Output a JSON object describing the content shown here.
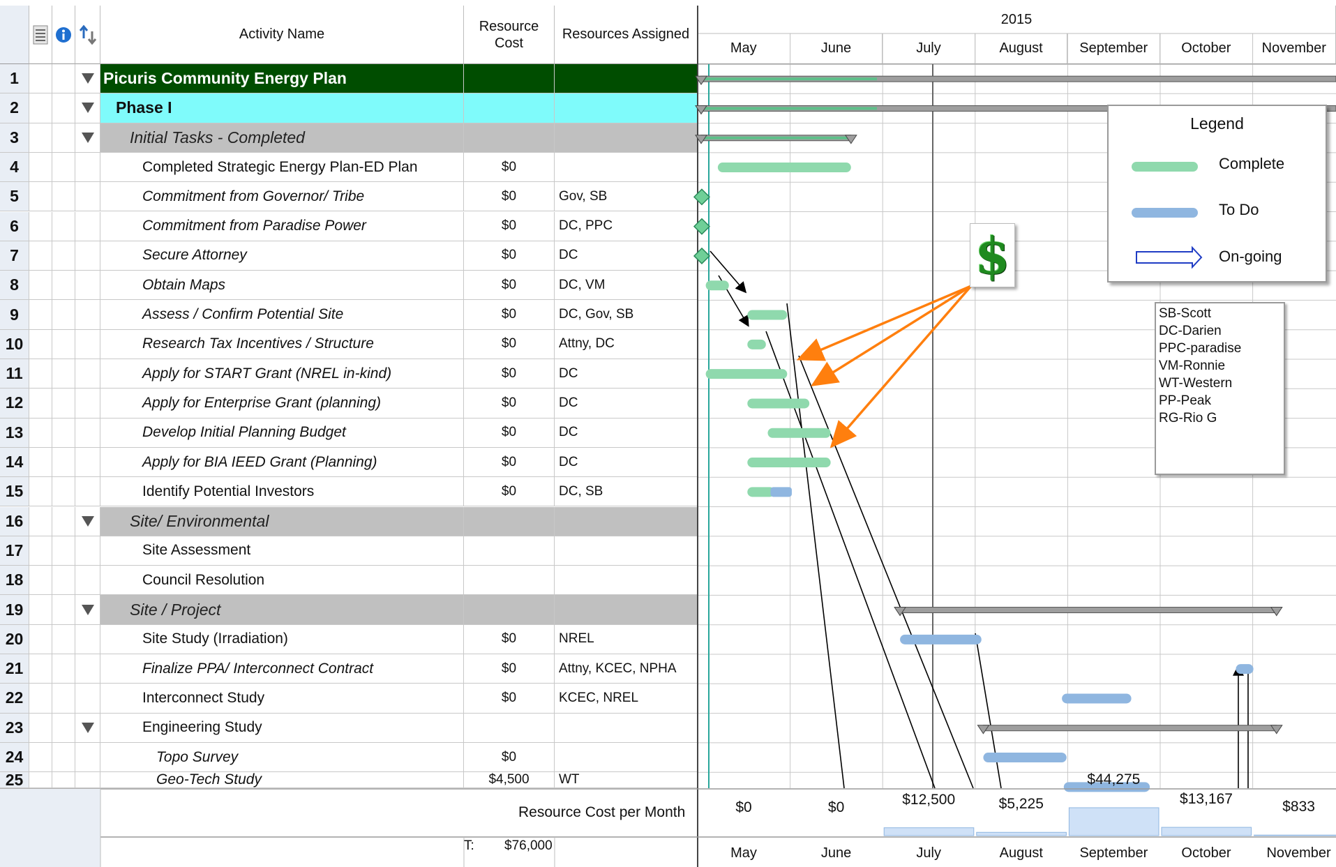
{
  "header": {
    "activity_name": "Activity Name",
    "resource_cost": "Resource Cost",
    "resources_assigned": "Resources Assigned",
    "year": "2015",
    "months": [
      "May",
      "June",
      "July",
      "August",
      "September",
      "October",
      "November"
    ]
  },
  "icons": [
    "notes-icon",
    "info-icon",
    "link-icon"
  ],
  "rows": [
    {
      "num": "1",
      "name": "Picuris Community Energy Plan",
      "cost": "",
      "res": "",
      "level": "root",
      "toggle": true,
      "italic": false,
      "indent": 0
    },
    {
      "num": "2",
      "name": "Phase I",
      "cost": "",
      "res": "",
      "level": "phase",
      "toggle": true,
      "italic": false,
      "indent": 1
    },
    {
      "num": "3",
      "name": "Initial Tasks - Completed",
      "cost": "",
      "res": "",
      "level": "sum",
      "toggle": true,
      "italic": true,
      "indent": 2
    },
    {
      "num": "4",
      "name": "Completed Strategic Energy Plan-ED Plan",
      "cost": "$0",
      "res": "",
      "level": "task",
      "toggle": false,
      "italic": false,
      "indent": 3
    },
    {
      "num": "5",
      "name": "Commitment from Governor/ Tribe",
      "cost": "$0",
      "res": "Gov, SB",
      "level": "task",
      "toggle": false,
      "italic": true,
      "indent": 3
    },
    {
      "num": "6",
      "name": "Commitment from Paradise Power",
      "cost": "$0",
      "res": "DC, PPC",
      "level": "task",
      "toggle": false,
      "italic": true,
      "indent": 3
    },
    {
      "num": "7",
      "name": "Secure Attorney",
      "cost": "$0",
      "res": "DC",
      "level": "task",
      "toggle": false,
      "italic": true,
      "indent": 3
    },
    {
      "num": "8",
      "name": "Obtain Maps",
      "cost": "$0",
      "res": "DC, VM",
      "level": "task",
      "toggle": false,
      "italic": true,
      "indent": 3
    },
    {
      "num": "9",
      "name": "Assess / Confirm Potential Site",
      "cost": "$0",
      "res": "DC, Gov, SB",
      "level": "task",
      "toggle": false,
      "italic": true,
      "indent": 3
    },
    {
      "num": "10",
      "name": "Research Tax Incentives / Structure",
      "cost": "$0",
      "res": "Attny, DC",
      "level": "task",
      "toggle": false,
      "italic": true,
      "indent": 3
    },
    {
      "num": "11",
      "name": "Apply for START Grant (NREL in-kind)",
      "cost": "$0",
      "res": "DC",
      "level": "task",
      "toggle": false,
      "italic": true,
      "indent": 3
    },
    {
      "num": "12",
      "name": "Apply for Enterprise Grant (planning)",
      "cost": "$0",
      "res": "DC",
      "level": "task",
      "toggle": false,
      "italic": true,
      "indent": 3
    },
    {
      "num": "13",
      "name": "Develop Initial Planning Budget",
      "cost": "$0",
      "res": "DC",
      "level": "task",
      "toggle": false,
      "italic": true,
      "indent": 3
    },
    {
      "num": "14",
      "name": "Apply for BIA IEED Grant (Planning)",
      "cost": "$0",
      "res": "DC",
      "level": "task",
      "toggle": false,
      "italic": true,
      "indent": 3
    },
    {
      "num": "15",
      "name": "Identify Potential Investors",
      "cost": "$0",
      "res": "DC, SB",
      "level": "task",
      "toggle": false,
      "italic": false,
      "indent": 3
    },
    {
      "num": "16",
      "name": "Site/ Environmental",
      "cost": "",
      "res": "",
      "level": "sum",
      "toggle": true,
      "italic": true,
      "indent": 2
    },
    {
      "num": "17",
      "name": "Site Assessment",
      "cost": "",
      "res": "",
      "level": "task",
      "toggle": false,
      "italic": false,
      "indent": 3
    },
    {
      "num": "18",
      "name": "Council Resolution",
      "cost": "",
      "res": "",
      "level": "task",
      "toggle": false,
      "italic": false,
      "indent": 3
    },
    {
      "num": "19",
      "name": "Site / Project",
      "cost": "",
      "res": "",
      "level": "sum",
      "toggle": true,
      "italic": true,
      "indent": 2
    },
    {
      "num": "20",
      "name": "Site Study (Irradiation)",
      "cost": "$0",
      "res": "NREL",
      "level": "task",
      "toggle": false,
      "italic": false,
      "indent": 3
    },
    {
      "num": "21",
      "name": "Finalize PPA/ Interconnect Contract",
      "cost": "$0",
      "res": "Attny, KCEC, NPHA",
      "level": "task",
      "toggle": false,
      "italic": true,
      "indent": 3
    },
    {
      "num": "22",
      "name": "Interconnect Study",
      "cost": "$0",
      "res": "KCEC, NREL",
      "level": "task",
      "toggle": false,
      "italic": false,
      "indent": 3
    },
    {
      "num": "23",
      "name": "Engineering Study",
      "cost": "",
      "res": "",
      "level": "task",
      "toggle": true,
      "italic": false,
      "indent": 3
    },
    {
      "num": "24",
      "name": "Topo Survey",
      "cost": "$0",
      "res": "",
      "level": "task",
      "toggle": false,
      "italic": true,
      "indent": 4
    },
    {
      "num": "25",
      "name": "Geo-Tech Study",
      "cost": "$4,500",
      "res": "WT",
      "level": "task",
      "toggle": false,
      "italic": true,
      "indent": 4
    }
  ],
  "bars": [
    {
      "row": 0,
      "type": "summary",
      "start": 0.0,
      "end": 7.0,
      "progress": 1.9
    },
    {
      "row": 1,
      "type": "summary",
      "start": 0.0,
      "end": 7.0,
      "progress": 1.9
    },
    {
      "row": 2,
      "type": "summary",
      "start": 0.0,
      "end": 1.62,
      "progress": 1.62
    },
    {
      "row": 3,
      "type": "complete",
      "start": 0.18,
      "end": 1.62
    },
    {
      "row": 4,
      "type": "milestone",
      "start": 0.03
    },
    {
      "row": 5,
      "type": "milestone",
      "start": 0.03
    },
    {
      "row": 6,
      "type": "milestone",
      "start": 0.03
    },
    {
      "row": 7,
      "type": "complete",
      "start": 0.05,
      "end": 0.3
    },
    {
      "row": 8,
      "type": "complete",
      "start": 0.5,
      "end": 0.93
    },
    {
      "row": 9,
      "type": "complete",
      "start": 0.5,
      "end": 0.7
    },
    {
      "row": 10,
      "type": "complete",
      "start": 0.05,
      "end": 0.93
    },
    {
      "row": 11,
      "type": "complete",
      "start": 0.5,
      "end": 1.17
    },
    {
      "row": 12,
      "type": "complete",
      "start": 0.72,
      "end": 1.4
    },
    {
      "row": 13,
      "type": "complete",
      "start": 0.5,
      "end": 1.4
    },
    {
      "row": 14,
      "type": "mixed",
      "start": 0.5,
      "end": 0.98,
      "split": 0.75
    },
    {
      "row": 18,
      "type": "summary",
      "start": 2.15,
      "end": 6.22,
      "progress": 0
    },
    {
      "row": 19,
      "type": "todo",
      "start": 2.15,
      "end": 3.03
    },
    {
      "row": 20,
      "type": "todo",
      "start": 5.78,
      "end": 5.97
    },
    {
      "row": 21,
      "type": "todo",
      "start": 3.9,
      "end": 4.65
    },
    {
      "row": 22,
      "type": "summary",
      "start": 3.05,
      "end": 6.22,
      "progress": 0
    },
    {
      "row": 23,
      "type": "todo",
      "start": 3.05,
      "end": 3.95
    },
    {
      "row": 24,
      "type": "todo",
      "start": 3.92,
      "end": 4.85
    }
  ],
  "footer": {
    "label": "Resource Cost per Month",
    "total_label": "T:",
    "total_value": "$76,000",
    "costs": [
      {
        "label": "$0",
        "value": 0
      },
      {
        "label": "$0",
        "value": 0
      },
      {
        "label": "$12,500",
        "value": 12500
      },
      {
        "label": "$5,225",
        "value": 5225
      },
      {
        "label": "$44,275",
        "value": 44275
      },
      {
        "label": "$13,167",
        "value": 13167
      },
      {
        "label": "$833",
        "value": 833
      }
    ]
  },
  "legend": {
    "title": "Legend",
    "items": [
      {
        "label": "Complete",
        "kind": "complete"
      },
      {
        "label": "To Do",
        "kind": "todo"
      },
      {
        "label": "On-going",
        "kind": "ongoing"
      }
    ]
  },
  "abbreviations": [
    "SB-Scott",
    "DC-Darien",
    "PPC-paradise",
    "VM-Ronnie",
    "WT-Western",
    "PP-Peak",
    "RG-Rio G"
  ],
  "colors": {
    "root_bg": "#004d00",
    "phase_bg": "#7ffbfb",
    "summary_bg": "#c0c0c0",
    "complete_bar": "#8fd9ad",
    "todo_bar": "#8fb6e0",
    "arrow_orange": "#ff7f0e",
    "dollar_green": "#1f8a1f"
  }
}
